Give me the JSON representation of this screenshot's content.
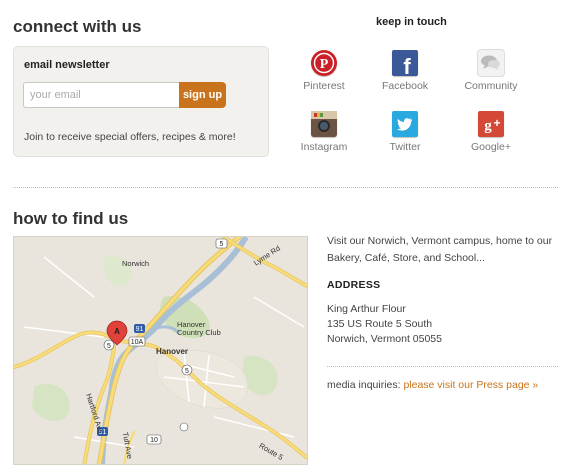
{
  "connect": {
    "title": "connect with us",
    "newsletter": {
      "label": "email newsletter",
      "placeholder": "your email",
      "signup_label": "sign up",
      "note": "Join to receive special offers, recipes & more!"
    }
  },
  "keep_in_touch": {
    "title": "keep in touch",
    "items": [
      {
        "label": "Pinterest",
        "icon": "pinterest-icon",
        "color": "#cb2027"
      },
      {
        "label": "Facebook",
        "icon": "facebook-icon",
        "color": "#3b5998"
      },
      {
        "label": "Community",
        "icon": "community-icon",
        "color": "#c4c4c4"
      },
      {
        "label": "Instagram",
        "icon": "instagram-icon",
        "color": "#6b5443"
      },
      {
        "label": "Twitter",
        "icon": "twitter-icon",
        "color": "#2aa9e0"
      },
      {
        "label": "Google+",
        "icon": "google-plus-icon",
        "color": "#d34836"
      }
    ]
  },
  "find": {
    "title": "how to find us",
    "map_labels": {
      "norwich": "Norwich",
      "hanover": "Hanover",
      "country_club": "Hanover Country Club",
      "marker": "A",
      "route_91": "91",
      "route_10a": "10A",
      "route_10": "10",
      "route_5": "5",
      "lyme_rd": "Lyme Rd",
      "route5_road": "Route 5",
      "hartford_ave": "Hartford Ave",
      "tuft_ave": "Tuft Ave"
    },
    "visit_text": "Visit our Norwich, Vermont campus, home to our Bakery, Café, Store, and School...",
    "address_title": "ADDRESS",
    "address_lines": [
      "King Arthur Flour",
      "135 US Route 5 South",
      "Norwich, Vermont 05055"
    ],
    "media_prefix": "media inquiries: ",
    "media_link": "please visit our Press page »"
  },
  "colors": {
    "accent": "#c9741c"
  }
}
